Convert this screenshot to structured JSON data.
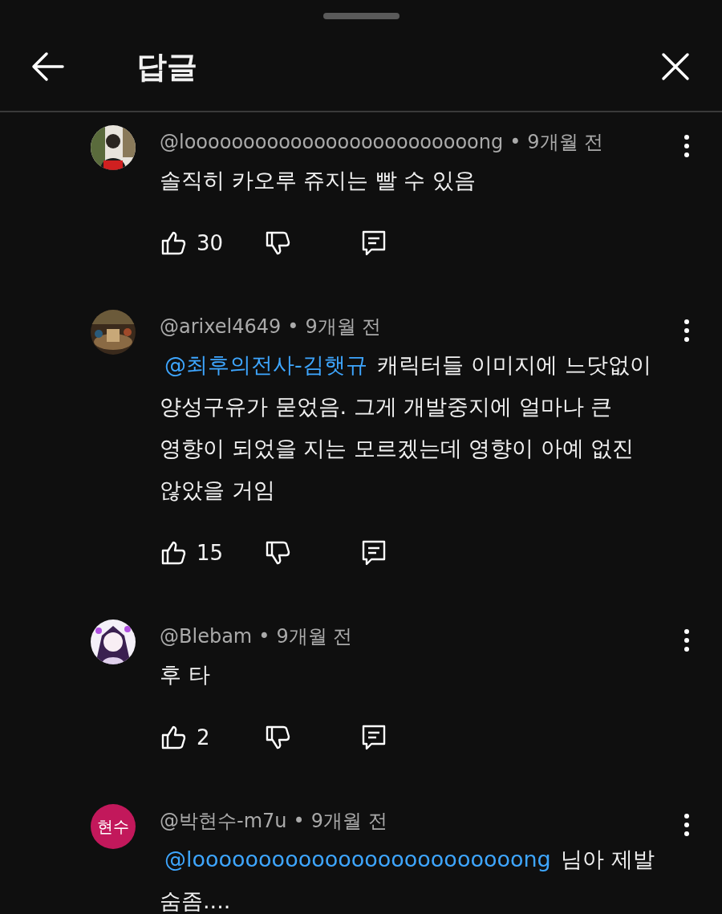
{
  "header": {
    "title": "답글"
  },
  "comments": [
    {
      "author": "@looooooooooooooooooooooooong",
      "separator": "•",
      "time": "9개월 전",
      "text": "솔직히 카오루 쥬지는 빨 수 있음",
      "likes": "30"
    },
    {
      "author": "@arixel4649",
      "separator": "•",
      "time": "9개월 전",
      "mention": "@최후의전사-김햇규",
      "text": "캐릭터들 이미지에 느닷없이 양성구유가 묻었음. 그게 개발중지에 얼마나 큰 영향이 되었을 지는 모르겠는데 영향이 아예 없진 않았을 거임",
      "likes": "15"
    },
    {
      "author": "@Blebam",
      "separator": "•",
      "time": "9개월 전",
      "text": "후 타",
      "likes": "2"
    },
    {
      "avatar": {
        "kind": "initials",
        "text": "현수",
        "color": "#c2185b"
      },
      "author": "@박현수-m7u",
      "separator": "•",
      "time": "9개월 전",
      "mention": "@looooooooooooooooooooooooong",
      "text": "님아 제발 숨좀...."
    }
  ]
}
